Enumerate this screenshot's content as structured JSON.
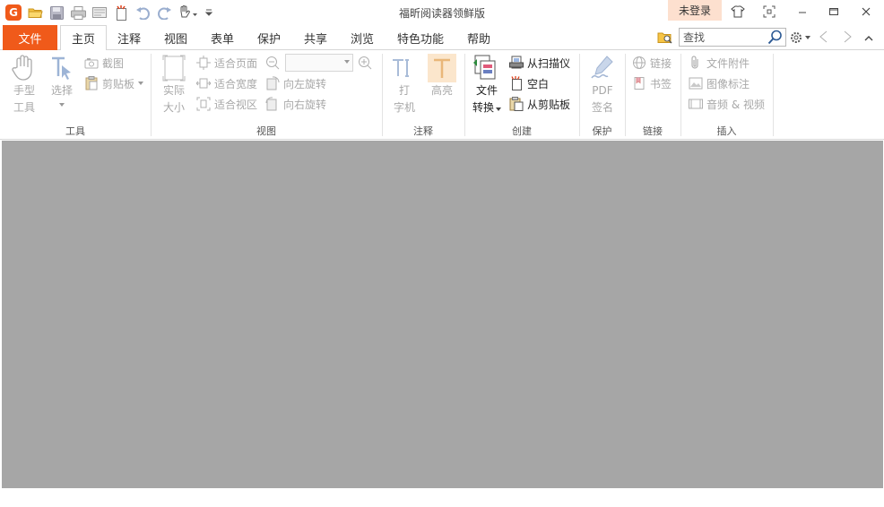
{
  "window": {
    "title": "福昕阅读器领鲜版",
    "login_label": "未登录"
  },
  "quick_access": {
    "logo_letter": "G",
    "icons": [
      "open-folder-icon",
      "save-icon",
      "print-icon",
      "email-icon",
      "new-icon",
      "undo-icon",
      "redo-icon",
      "hand-tool-icon",
      "customize-dropdown-icon"
    ]
  },
  "tabs": {
    "file": "文件",
    "items": [
      {
        "label": "主页",
        "active": true
      },
      {
        "label": "注释"
      },
      {
        "label": "视图"
      },
      {
        "label": "表单"
      },
      {
        "label": "保护"
      },
      {
        "label": "共享"
      },
      {
        "label": "浏览"
      },
      {
        "label": "特色功能"
      },
      {
        "label": "帮助"
      }
    ]
  },
  "search": {
    "placeholder": "查找"
  },
  "groups": {
    "tools": {
      "label": "工具",
      "hand_line1": "手型",
      "hand_line2": "工具",
      "select": "选择",
      "screenshot": "截图",
      "clipboard": "剪贴板"
    },
    "view": {
      "label": "视图",
      "actual_size_line1": "实际",
      "actual_size_line2": "大小",
      "fit_page": "适合页面",
      "fit_width": "适合宽度",
      "fit_visible": "适合视区",
      "rotate_left": "向左旋转",
      "rotate_right": "向右旋转",
      "zoom_value": ""
    },
    "comment": {
      "label": "注释",
      "typewriter_line1": "打",
      "typewriter_line2": "字机",
      "highlight": "高亮"
    },
    "create": {
      "label": "创建",
      "file_convert_line1": "文件",
      "file_convert_line2": "转换",
      "from_scanner": "从扫描仪",
      "blank": "空白",
      "from_clipboard": "从剪贴板"
    },
    "protect": {
      "label": "保护",
      "pdf_sign_line1": "PDF",
      "pdf_sign_line2": "签名"
    },
    "links": {
      "label": "链接",
      "link": "链接",
      "bookmark": "书签"
    },
    "insert": {
      "label": "插入",
      "attachment": "文件附件",
      "image_annotation": "图像标注",
      "audio_video": "音频 & 视频"
    }
  },
  "colors": {
    "accent": "#f05a1a",
    "login_bg": "#fde0cf",
    "doc_bg": "#a6a6a6"
  }
}
